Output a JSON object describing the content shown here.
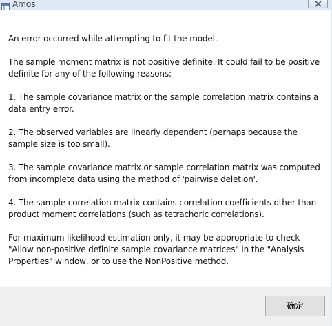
{
  "window": {
    "title": "Amos"
  },
  "message": {
    "paragraphs": [
      "An error occurred while attempting to fit the model.",
      "The sample moment matrix is not positive definite. It could fail to be positive definite for any of the following reasons:",
      "1. The sample covariance matrix or the sample correlation matrix contains a data entry error.",
      "2. The observed variables are linearly dependent (perhaps because the sample size is too small).",
      "3. The sample covariance matrix or sample correlation matrix was computed from incomplete data using the method of 'pairwise deletion'.",
      "4. The sample correlation matrix contains correlation coefficients other than product moment correlations (such as tetrachoric correlations).",
      "For maximum likelihood estimation only, it may be appropriate to check \"Allow non-positive definite sample covariance matrices\" in the \"Analysis Properties\" window, or to use the NonPositive method."
    ]
  },
  "buttons": {
    "ok_label": "确定"
  },
  "icons": {
    "app": "app-window-icon",
    "close": "close-icon"
  }
}
